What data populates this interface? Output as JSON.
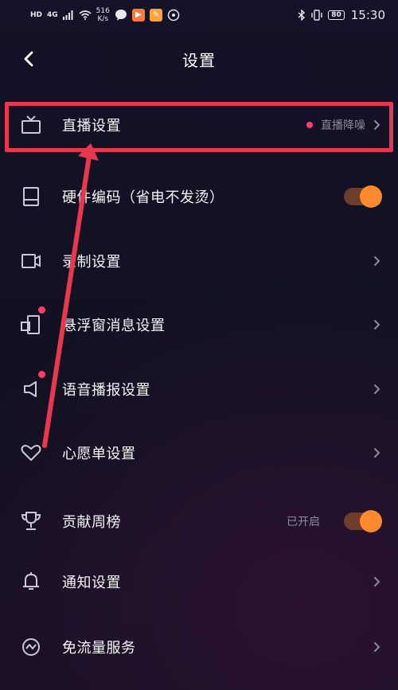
{
  "status_bar": {
    "hd": "HD",
    "net": "4G",
    "speed_value": "516",
    "speed_unit": "K/s",
    "battery": "80",
    "time": "15:30"
  },
  "header": {
    "title": "设置"
  },
  "rows": [
    {
      "label": "直播设置",
      "value": "直播降噪",
      "icon": "tv-icon",
      "has_dot": true
    },
    {
      "label": "硬件编码（省电不发烫）",
      "icon": "device-icon",
      "toggle": "on"
    },
    {
      "label": "录制设置",
      "icon": "camera-icon"
    },
    {
      "label": "悬浮窗消息设置",
      "icon": "floating-window-icon",
      "icon_badge": true
    },
    {
      "label": "语音播报设置",
      "icon": "speaker-icon",
      "icon_badge": true
    },
    {
      "label": "心愿单设置",
      "icon": "heart-icon"
    },
    {
      "label": "贡献周榜",
      "value": "已开启",
      "icon": "trophy-icon",
      "toggle": "on"
    },
    {
      "label": "通知设置",
      "icon": "bell-icon"
    },
    {
      "label": "免流量服务",
      "icon": "data-saver-icon"
    }
  ],
  "colors": {
    "accent_orange": "#ff8a2d",
    "dot_pink": "#ff3d6b",
    "annotation_red": "#e8384f"
  }
}
